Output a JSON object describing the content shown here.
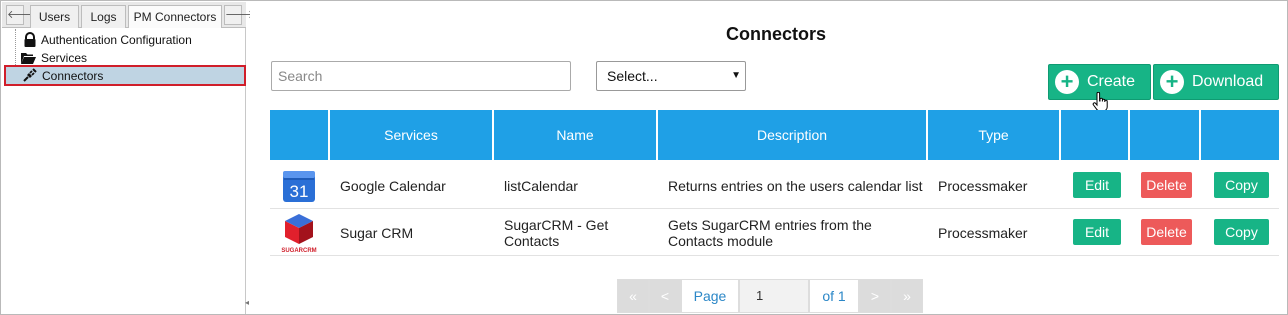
{
  "left_panel": {
    "tabs": [
      "Users",
      "Logs",
      "PM Connectors"
    ],
    "scroll_left": "🡐",
    "scroll_right": "🡒",
    "tree": {
      "auth": "Authentication Configuration",
      "services": "Services",
      "connectors": "Connectors"
    },
    "split_handle": "◂"
  },
  "main": {
    "title": "Connectors",
    "search_placeholder": "Search",
    "select_value": "Select...",
    "select_arrow": "▼",
    "create_label": "Create",
    "download_label": "Download",
    "plus": "+",
    "columns": [
      "",
      "Services",
      "Name",
      "Description",
      "Type",
      "",
      "",
      ""
    ],
    "rows": [
      {
        "icon": "google-calendar-icon",
        "calendar_day": "31",
        "service": "Google Calendar",
        "name": "listCalendar",
        "description": "Returns entries on the users calendar list",
        "type": "Processmaker",
        "edit": "Edit",
        "delete": "Delete",
        "copy": "Copy"
      },
      {
        "icon": "sugarcrm-icon",
        "logo_text": "SUGARCRM",
        "service": "Sugar CRM",
        "name": "SugarCRM - Get Contacts",
        "description": "Gets SugarCRM entries from the Contacts module",
        "type": "Processmaker",
        "edit": "Edit",
        "delete": "Delete",
        "copy": "Copy"
      }
    ],
    "pager": {
      "first": "«",
      "prev": "<",
      "page_label": "Page",
      "page_value": "1",
      "of_label": "of 1",
      "next": ">",
      "last": "»"
    }
  },
  "colors": {
    "header_blue": "#1fa0e6",
    "green": "#17b486",
    "red": "#ed5a5a",
    "selected_row": "#bfd4e3",
    "selected_border": "#d01e2a"
  }
}
